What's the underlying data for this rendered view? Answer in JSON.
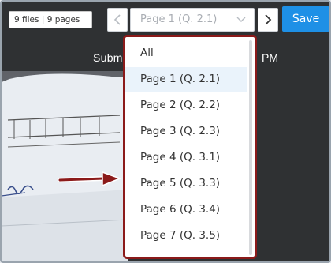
{
  "toolbar": {
    "files_label": "9 files | 9 pages",
    "prev_icon": "chevron-left",
    "next_icon": "chevron-right",
    "page_select": {
      "value": "Page 1 (Q. 2.1)",
      "icon": "chevron-down"
    },
    "save_label": "Save"
  },
  "background": {
    "submitted_prefix": "Subm",
    "submitted_suffix": "PM"
  },
  "dropdown": {
    "options": [
      {
        "label": "All"
      },
      {
        "label": "Page 1 (Q. 2.1)",
        "selected": true
      },
      {
        "label": "Page 2 (Q. 2.2)"
      },
      {
        "label": "Page 3 (Q. 2.3)"
      },
      {
        "label": "Page 4 (Q. 3.1)"
      },
      {
        "label": "Page 5 (Q. 3.3)"
      },
      {
        "label": "Page 6 (Q. 3.4)"
      },
      {
        "label": "Page 7 (Q. 3.5)"
      }
    ],
    "highlight_color": "#8b1a1a"
  },
  "colors": {
    "save_button": "#1e90e6",
    "toolbar_bg": "#2f3133",
    "annotation": "#8b1a1a"
  }
}
